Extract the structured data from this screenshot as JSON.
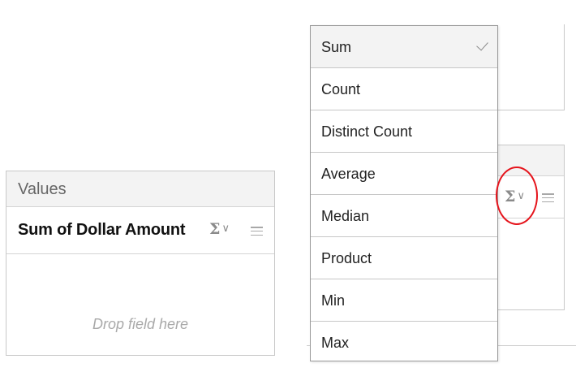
{
  "values_panel": {
    "header": "Values",
    "field": {
      "label": "Sum of Dollar Amount",
      "sigma_icon": "Σ",
      "chevron_icon": "∨"
    },
    "drop_placeholder": "Drop field here"
  },
  "aggregation_menu": {
    "items": [
      {
        "label": "Sum",
        "selected": true
      },
      {
        "label": "Count",
        "selected": false
      },
      {
        "label": "Distinct Count",
        "selected": false
      },
      {
        "label": "Average",
        "selected": false
      },
      {
        "label": "Median",
        "selected": false
      },
      {
        "label": "Product",
        "selected": false
      },
      {
        "label": "Min",
        "selected": false
      },
      {
        "label": "Max",
        "selected": false
      }
    ]
  },
  "right_field": {
    "sigma_icon": "Σ",
    "chevron_icon": "∨"
  },
  "colors": {
    "highlight_circle": "#e5141c",
    "header_bg": "#f3f3f3",
    "border": "#c8c8c8",
    "icon_gray": "#8a8a8a"
  },
  "icons": [
    "sigma-icon",
    "chevron-down-icon",
    "hamburger-menu-icon",
    "check-icon"
  ]
}
